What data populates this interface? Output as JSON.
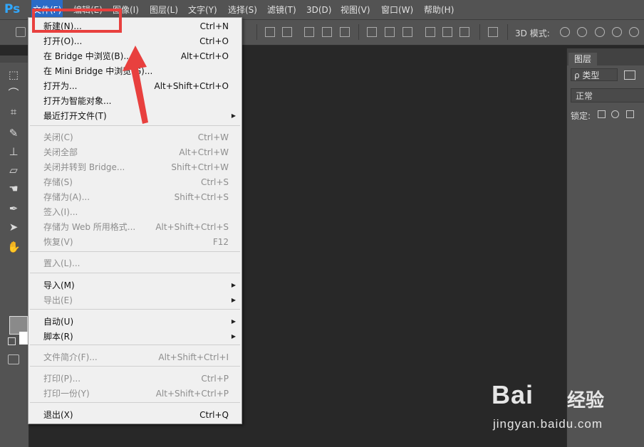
{
  "app": {
    "logo": "Ps",
    "accent_color": "#31a8ff",
    "menu_highlight_color": "#2a6bc7"
  },
  "menubar": {
    "items": [
      "文件(F)",
      "编辑(E)",
      "图像(I)",
      "图层(L)",
      "文字(Y)",
      "选择(S)",
      "滤镜(T)",
      "3D(D)",
      "视图(V)",
      "窗口(W)",
      "帮助(H)"
    ]
  },
  "options_bar": {
    "mode3d_label": "3D 模式:"
  },
  "layers_panel": {
    "tab": "图层",
    "filter": "ρ 类型",
    "blend_mode": "正常",
    "lock_label": "锁定:"
  },
  "file_menu": {
    "items": [
      {
        "label": "新建(N)...",
        "shortcut": "Ctrl+N",
        "enabled": true
      },
      {
        "label": "打开(O)...",
        "shortcut": "Ctrl+O",
        "enabled": true
      },
      {
        "label": "在 Bridge 中浏览(B)...",
        "shortcut": "Alt+Ctrl+O",
        "enabled": true
      },
      {
        "label": "在 Mini Bridge 中浏览(G)...",
        "shortcut": "",
        "enabled": true
      },
      {
        "label": "打开为...",
        "shortcut": "Alt+Shift+Ctrl+O",
        "enabled": true
      },
      {
        "label": "打开为智能对象...",
        "shortcut": "",
        "enabled": true
      },
      {
        "label": "最近打开文件(T)",
        "shortcut": "",
        "enabled": true,
        "submenu": true
      },
      {
        "label": "关闭(C)",
        "shortcut": "Ctrl+W",
        "enabled": false
      },
      {
        "label": "关闭全部",
        "shortcut": "Alt+Ctrl+W",
        "enabled": false
      },
      {
        "label": "关闭并转到 Bridge...",
        "shortcut": "Shift+Ctrl+W",
        "enabled": false
      },
      {
        "label": "存储(S)",
        "shortcut": "Ctrl+S",
        "enabled": false
      },
      {
        "label": "存储为(A)...",
        "shortcut": "Shift+Ctrl+S",
        "enabled": false
      },
      {
        "label": "签入(I)...",
        "shortcut": "",
        "enabled": false
      },
      {
        "label": "存储为 Web 所用格式...",
        "shortcut": "Alt+Shift+Ctrl+S",
        "enabled": false
      },
      {
        "label": "恢复(V)",
        "shortcut": "F12",
        "enabled": false
      },
      {
        "label": "置入(L)...",
        "shortcut": "",
        "enabled": false
      },
      {
        "label": "导入(M)",
        "shortcut": "",
        "enabled": true,
        "submenu": true
      },
      {
        "label": "导出(E)",
        "shortcut": "",
        "enabled": false,
        "submenu": true
      },
      {
        "label": "自动(U)",
        "shortcut": "",
        "enabled": true,
        "submenu": true
      },
      {
        "label": "脚本(R)",
        "shortcut": "",
        "enabled": true,
        "submenu": true
      },
      {
        "label": "文件简介(F)...",
        "shortcut": "Alt+Shift+Ctrl+I",
        "enabled": false
      },
      {
        "label": "打印(P)...",
        "shortcut": "Ctrl+P",
        "enabled": false
      },
      {
        "label": "打印一份(Y)",
        "shortcut": "Alt+Shift+Ctrl+P",
        "enabled": false
      },
      {
        "label": "退出(X)",
        "shortcut": "Ctrl+Q",
        "enabled": true
      }
    ]
  },
  "annotation": {
    "color": "#e8403e"
  },
  "watermark": {
    "brand": "Bai",
    "brand_cn": "经验",
    "url": "jingyan.baidu.com"
  }
}
